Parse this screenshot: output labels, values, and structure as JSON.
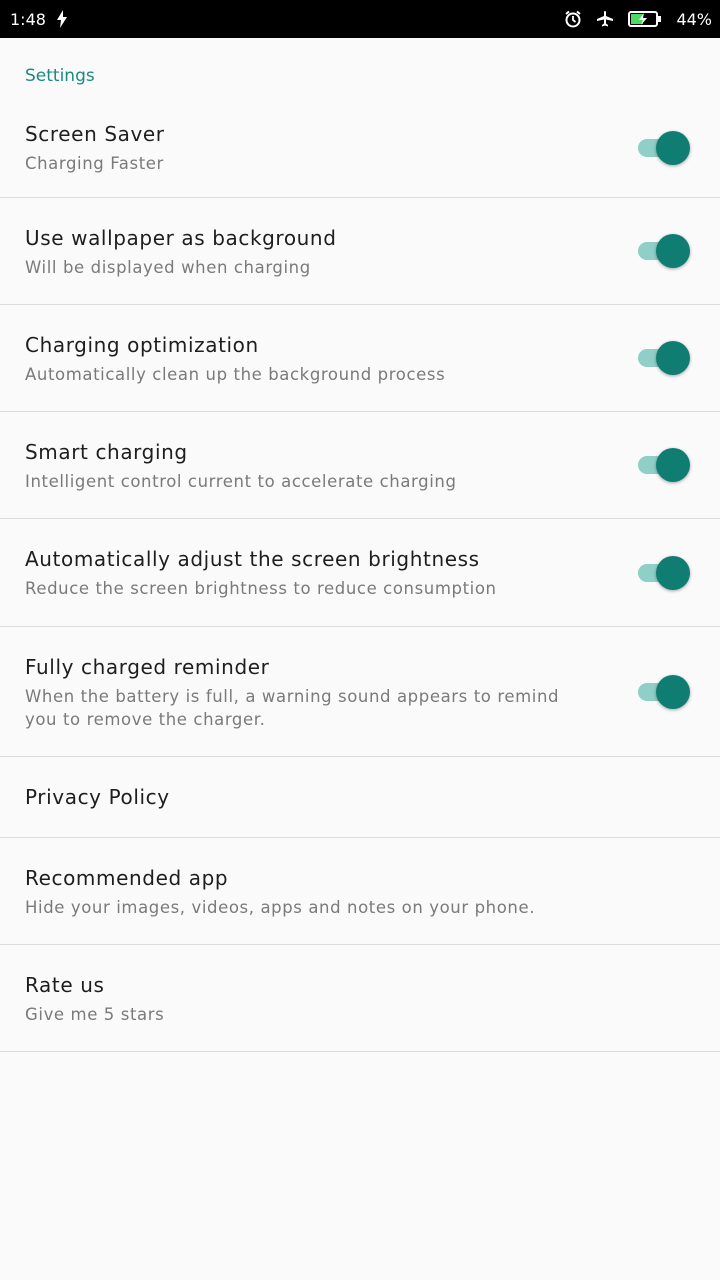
{
  "status_bar": {
    "time": "1:48",
    "battery_percent": "44%"
  },
  "section": {
    "title": "Settings"
  },
  "items": [
    {
      "title": "Screen Saver",
      "subtitle": "Charging Faster",
      "toggle": true
    },
    {
      "title": "Use wallpaper as background",
      "subtitle": "Will be displayed when charging",
      "toggle": true
    },
    {
      "title": "Charging optimization",
      "subtitle": "Automatically clean up the background process",
      "toggle": true
    },
    {
      "title": "Smart charging",
      "subtitle": "Intelligent control current to accelerate charging",
      "toggle": true
    },
    {
      "title": "Automatically adjust the screen brightness",
      "subtitle": "Reduce the screen brightness to reduce consumption",
      "toggle": true
    },
    {
      "title": "Fully charged reminder",
      "subtitle": "When the battery is full, a warning sound appears to remind you to remove the charger.",
      "toggle": true
    },
    {
      "title": "Privacy Policy"
    },
    {
      "title": "Recommended app",
      "subtitle": "Hide your images, videos, apps and notes on your phone."
    },
    {
      "title": "Rate us",
      "subtitle": "Give me 5 stars"
    }
  ],
  "colors": {
    "accent": "#1b8a7e",
    "switch_thumb": "#107d72",
    "switch_track": "#8fcfc7"
  }
}
